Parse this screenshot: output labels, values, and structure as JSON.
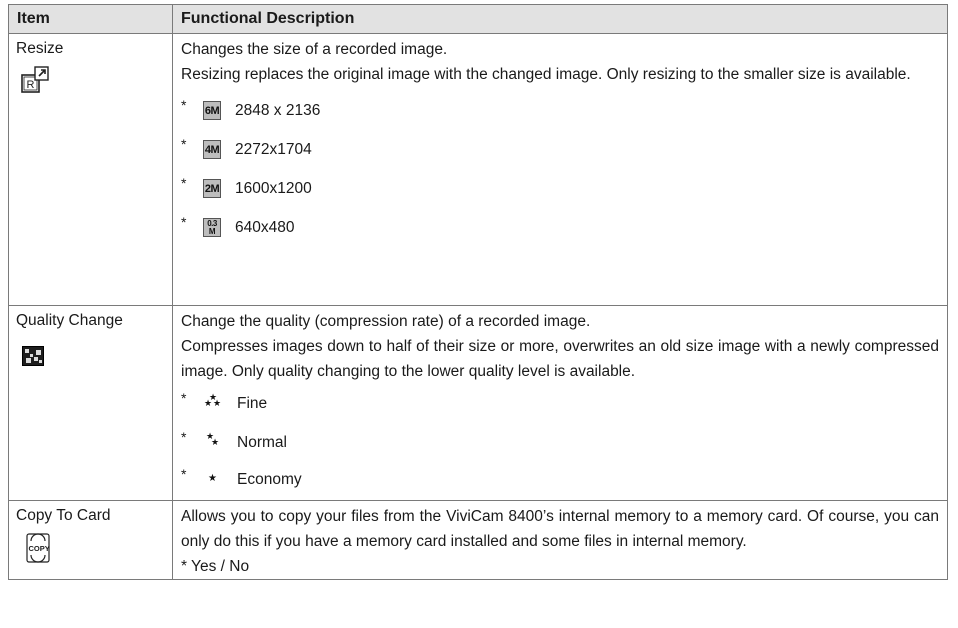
{
  "table": {
    "header_item": "Item",
    "header_desc": "Functional Description",
    "rows": [
      {
        "item": "Resize",
        "icon": "resize-icon",
        "desc1": "Changes the size of a recorded image.",
        "desc2": "Resizing replaces the original image with the changed image.  Only resizing to the smaller size is available.",
        "options": [
          {
            "badge": "6M",
            "value": "2848 x 2136"
          },
          {
            "badge": "4M",
            "value": "2272x1704"
          },
          {
            "badge": "2M",
            "value": "1600x1200"
          },
          {
            "badge_top": "0.3",
            "badge_bottom": "M",
            "value": "640x480"
          }
        ]
      },
      {
        "item": "Quality Change",
        "icon": "quality-change-icon",
        "desc1": "Change the quality (compression rate) of a recorded image.",
        "desc2": "Compresses images down to half of their size or more, overwrites an old size image with a newly compressed image.  Only quality changing to the lower quality level is available.",
        "options": [
          {
            "icon": "three-stars-icon",
            "value": "Fine"
          },
          {
            "icon": "two-stars-icon",
            "value": "Normal"
          },
          {
            "icon": "one-star-icon",
            "value": "Economy"
          }
        ]
      },
      {
        "item": "Copy To Card",
        "icon": "copy-to-card-icon",
        "icon_text": "COPY",
        "desc1": "Allows you to copy your files from the ViviCam 8400’s internal memory to a memory card. Of course, you can only do this if you have a memory card installed and some files in internal memory.",
        "desc2": "* Yes / No"
      }
    ]
  },
  "option_marker": "*"
}
